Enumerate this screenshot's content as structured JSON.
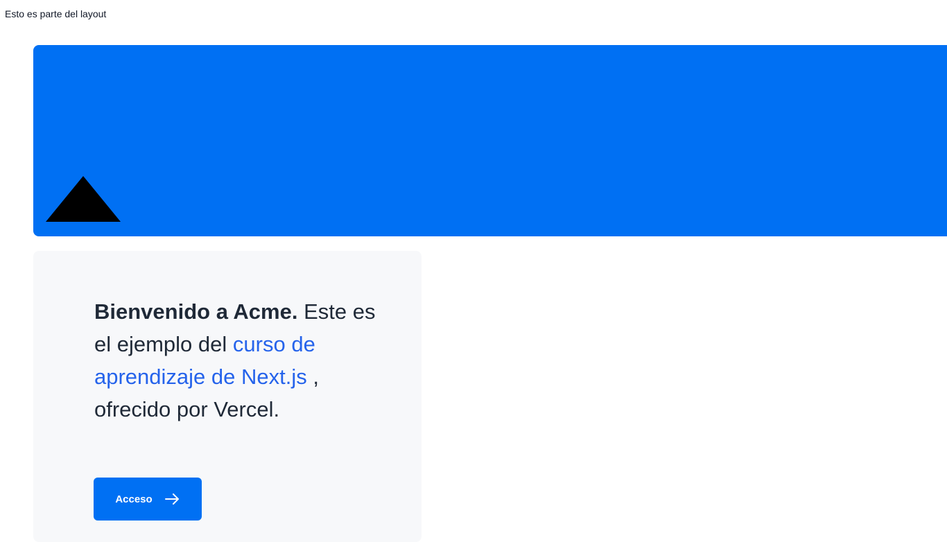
{
  "layout_note": "Esto es parte del layout",
  "colors": {
    "hero": "#0070f3",
    "card_background": "#f7f8fa",
    "link": "#2563eb",
    "button": "#0070f3"
  },
  "hero": {
    "logo_icon": "triangle-logo-icon"
  },
  "welcome": {
    "bold": "Bienvenido a Acme.",
    "text_before_link": " Este es el ejemplo del ",
    "link": "curso de aprendizaje de Next.js",
    "text_after_link": " , ofrecido por Vercel."
  },
  "button": {
    "label": "Acceso",
    "icon": "arrow-right-icon"
  }
}
